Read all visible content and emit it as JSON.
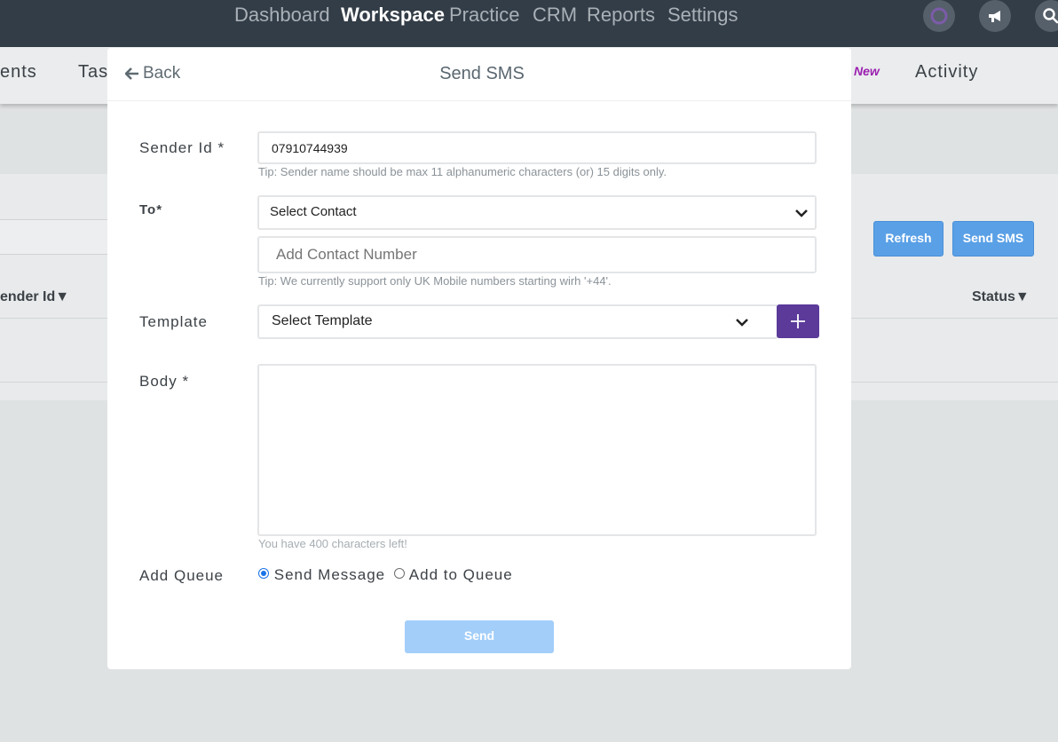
{
  "topnav": {
    "items": [
      "Dashboard",
      "Workspace",
      "Practice",
      "CRM",
      "Reports",
      "Settings"
    ],
    "active": "Workspace"
  },
  "subnav": {
    "items": [
      "ents",
      "Tas",
      "Activity"
    ],
    "new_badge": "New"
  },
  "background": {
    "refresh_label": "Refresh",
    "send_sms_label": "Send SMS",
    "columns": [
      "ender Id▼",
      "Status▼"
    ]
  },
  "modal": {
    "back_label": "Back",
    "title": "Send SMS",
    "sender_id": {
      "label": "Sender Id *",
      "value": "07910744939",
      "tip": "Tip: Sender name should be max 11 alphanumeric characters (or) 15 digits only."
    },
    "to": {
      "label": "To*",
      "select_value": "Select Contact",
      "number_placeholder": "Add Contact Number",
      "tip": "Tip: We currently support only UK Mobile numbers starting wirh '+44'."
    },
    "template": {
      "label": "Template",
      "select_value": "Select Template"
    },
    "body": {
      "label": "Body *",
      "value": "",
      "chars_left": "You have 400 characters left!"
    },
    "queue": {
      "label": "Add Queue",
      "options": [
        "Send Message",
        "Add to Queue"
      ],
      "selected": "Send Message"
    },
    "send_label": "Send"
  },
  "colors": {
    "nav_bg": "#333d47",
    "primary_button": "#5aa0e6",
    "disabled_button": "#a3cefa",
    "plus_button": "#5b3a9a",
    "new_badge": "#9b1fb0"
  }
}
